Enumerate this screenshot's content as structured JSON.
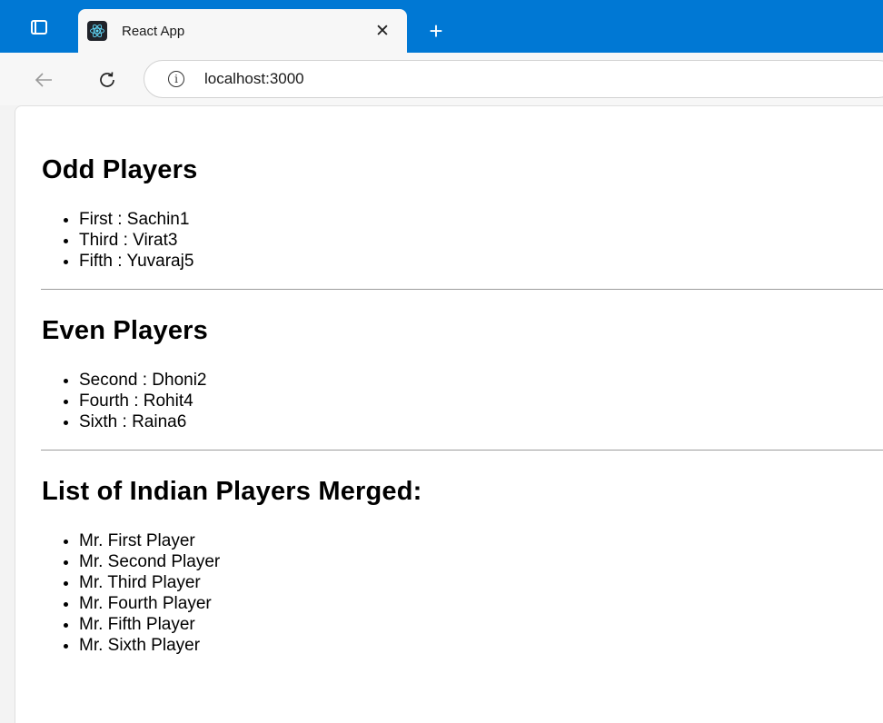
{
  "browser": {
    "tab_title": "React App",
    "close_glyph": "✕",
    "new_tab_glyph": "+",
    "url": "localhost:3000",
    "accent_color": "#0078d4"
  },
  "page": {
    "odd_heading": "Odd Players",
    "odd_players": [
      "First : Sachin1",
      "Third : Virat3",
      "Fifth : Yuvaraj5"
    ],
    "even_heading": "Even Players",
    "even_players": [
      "Second : Dhoni2",
      "Fourth : Rohit4",
      "Sixth : Raina6"
    ],
    "merged_heading": "List of Indian Players Merged:",
    "merged_players": [
      "Mr. First Player",
      "Mr. Second Player",
      "Mr. Third Player",
      "Mr. Fourth Player",
      "Mr. Fifth Player",
      "Mr. Sixth Player"
    ]
  },
  "icons": {
    "tab_actions": "tab-actions-icon",
    "favicon": "react-icon",
    "back": "back-arrow-icon",
    "refresh": "refresh-icon",
    "site_info": "info-icon"
  }
}
